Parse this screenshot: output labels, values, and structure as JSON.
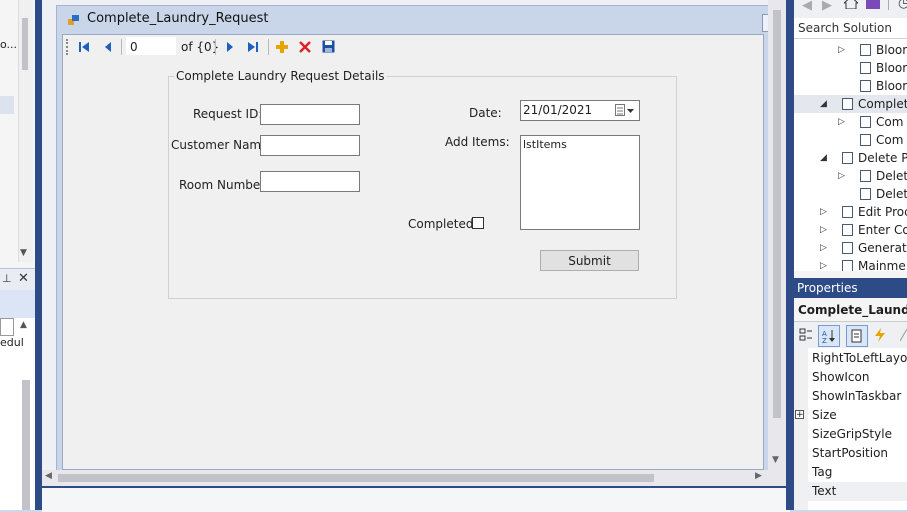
{
  "left_panel": {
    "top_text": "o...",
    "bottom_text": "edul"
  },
  "form": {
    "title": "Complete_Laundry_Request",
    "navigator": {
      "position_value": "0",
      "count_text": "of {0}"
    },
    "group": {
      "caption": "Complete Laundry Request Details",
      "request_id_label": "Request ID:",
      "customer_name_label": "Customer Name:",
      "room_number_label": "Room Number:",
      "date_label": "Date:",
      "date_value": "21/01/2021",
      "add_items_label": "Add Items:",
      "list_name": "lstItems",
      "completed_label": "Completed:",
      "submit_label": "Submit"
    }
  },
  "solution_explorer": {
    "search_placeholder": "Search Solution Explo",
    "items": [
      {
        "label": "Bloor",
        "indent": 3,
        "arrow": "▷"
      },
      {
        "label": "Bloor",
        "indent": 3,
        "arrow": ""
      },
      {
        "label": "Bloor",
        "indent": 3,
        "arrow": ""
      },
      {
        "label": "Complet",
        "indent": 2,
        "arrow": "◢",
        "selected": true
      },
      {
        "label": "Com",
        "indent": 3,
        "arrow": "▷"
      },
      {
        "label": "Com",
        "indent": 3,
        "arrow": ""
      },
      {
        "label": "Delete P",
        "indent": 2,
        "arrow": "◢"
      },
      {
        "label": "Delet",
        "indent": 3,
        "arrow": "▷"
      },
      {
        "label": "Delet",
        "indent": 3,
        "arrow": ""
      },
      {
        "label": "Edit Proc",
        "indent": 2,
        "arrow": "▷"
      },
      {
        "label": "Enter Co",
        "indent": 2,
        "arrow": "▷"
      },
      {
        "label": "Generate",
        "indent": 2,
        "arrow": "▷"
      },
      {
        "label": "Mainme",
        "indent": 2,
        "arrow": "▷"
      }
    ]
  },
  "properties": {
    "header": "Properties",
    "object": "Complete_Laundry_",
    "rows": [
      {
        "name": "RightToLeftLayout",
        "expand": false
      },
      {
        "name": "ShowIcon",
        "expand": false
      },
      {
        "name": "ShowInTaskbar",
        "expand": false
      },
      {
        "name": "Size",
        "expand": true
      },
      {
        "name": "SizeGripStyle",
        "expand": false
      },
      {
        "name": "StartPosition",
        "expand": false
      },
      {
        "name": "Tag",
        "expand": false
      },
      {
        "name": "Text",
        "expand": false
      }
    ]
  }
}
